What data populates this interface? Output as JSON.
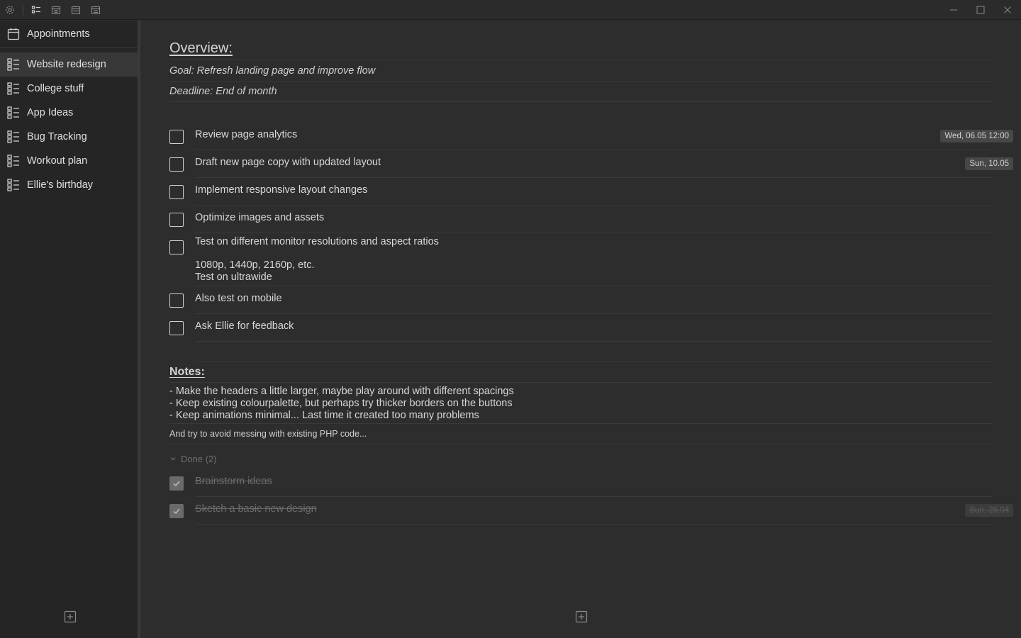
{
  "sidebar": {
    "appointments": "Appointments",
    "items": [
      {
        "label": "Website redesign"
      },
      {
        "label": "College stuff"
      },
      {
        "label": "App Ideas"
      },
      {
        "label": "Bug Tracking"
      },
      {
        "label": "Workout plan"
      },
      {
        "label": "Ellie's birthday"
      }
    ]
  },
  "overview": {
    "title": "Overview:",
    "goal": "Goal: Refresh landing page and improve flow",
    "deadline": "Deadline: End of month"
  },
  "tasks": [
    {
      "text": "Review page analytics",
      "date": "Wed, 06.05 12:00"
    },
    {
      "text": "Draft new page copy with updated layout",
      "date": "Sun, 10.05"
    },
    {
      "text": "Implement responsive layout changes"
    },
    {
      "text": "Optimize images and assets"
    },
    {
      "text": "Test on different monitor resolutions and aspect ratios",
      "sub1": "1080p, 1440p, 2160p, etc.",
      "sub2": "Test on ultrawide"
    },
    {
      "text": "Also test on mobile"
    },
    {
      "text": "Ask Ellie for feedback"
    }
  ],
  "notes": {
    "title": "Notes:",
    "line1": "- Make the headers a little larger, maybe play around with different spacings",
    "line2": "- Keep existing colourpalette, but perhaps try thicker borders on the buttons",
    "line3": "- Keep animations minimal... Last time it created too many problems",
    "extra": "And try to avoid messing with existing PHP code..."
  },
  "done": {
    "label": "Done (2)",
    "items": [
      {
        "text": "Brainstorm ideas"
      },
      {
        "text": "Sketch a basic new design",
        "date": "Sun, 26.04"
      }
    ]
  }
}
